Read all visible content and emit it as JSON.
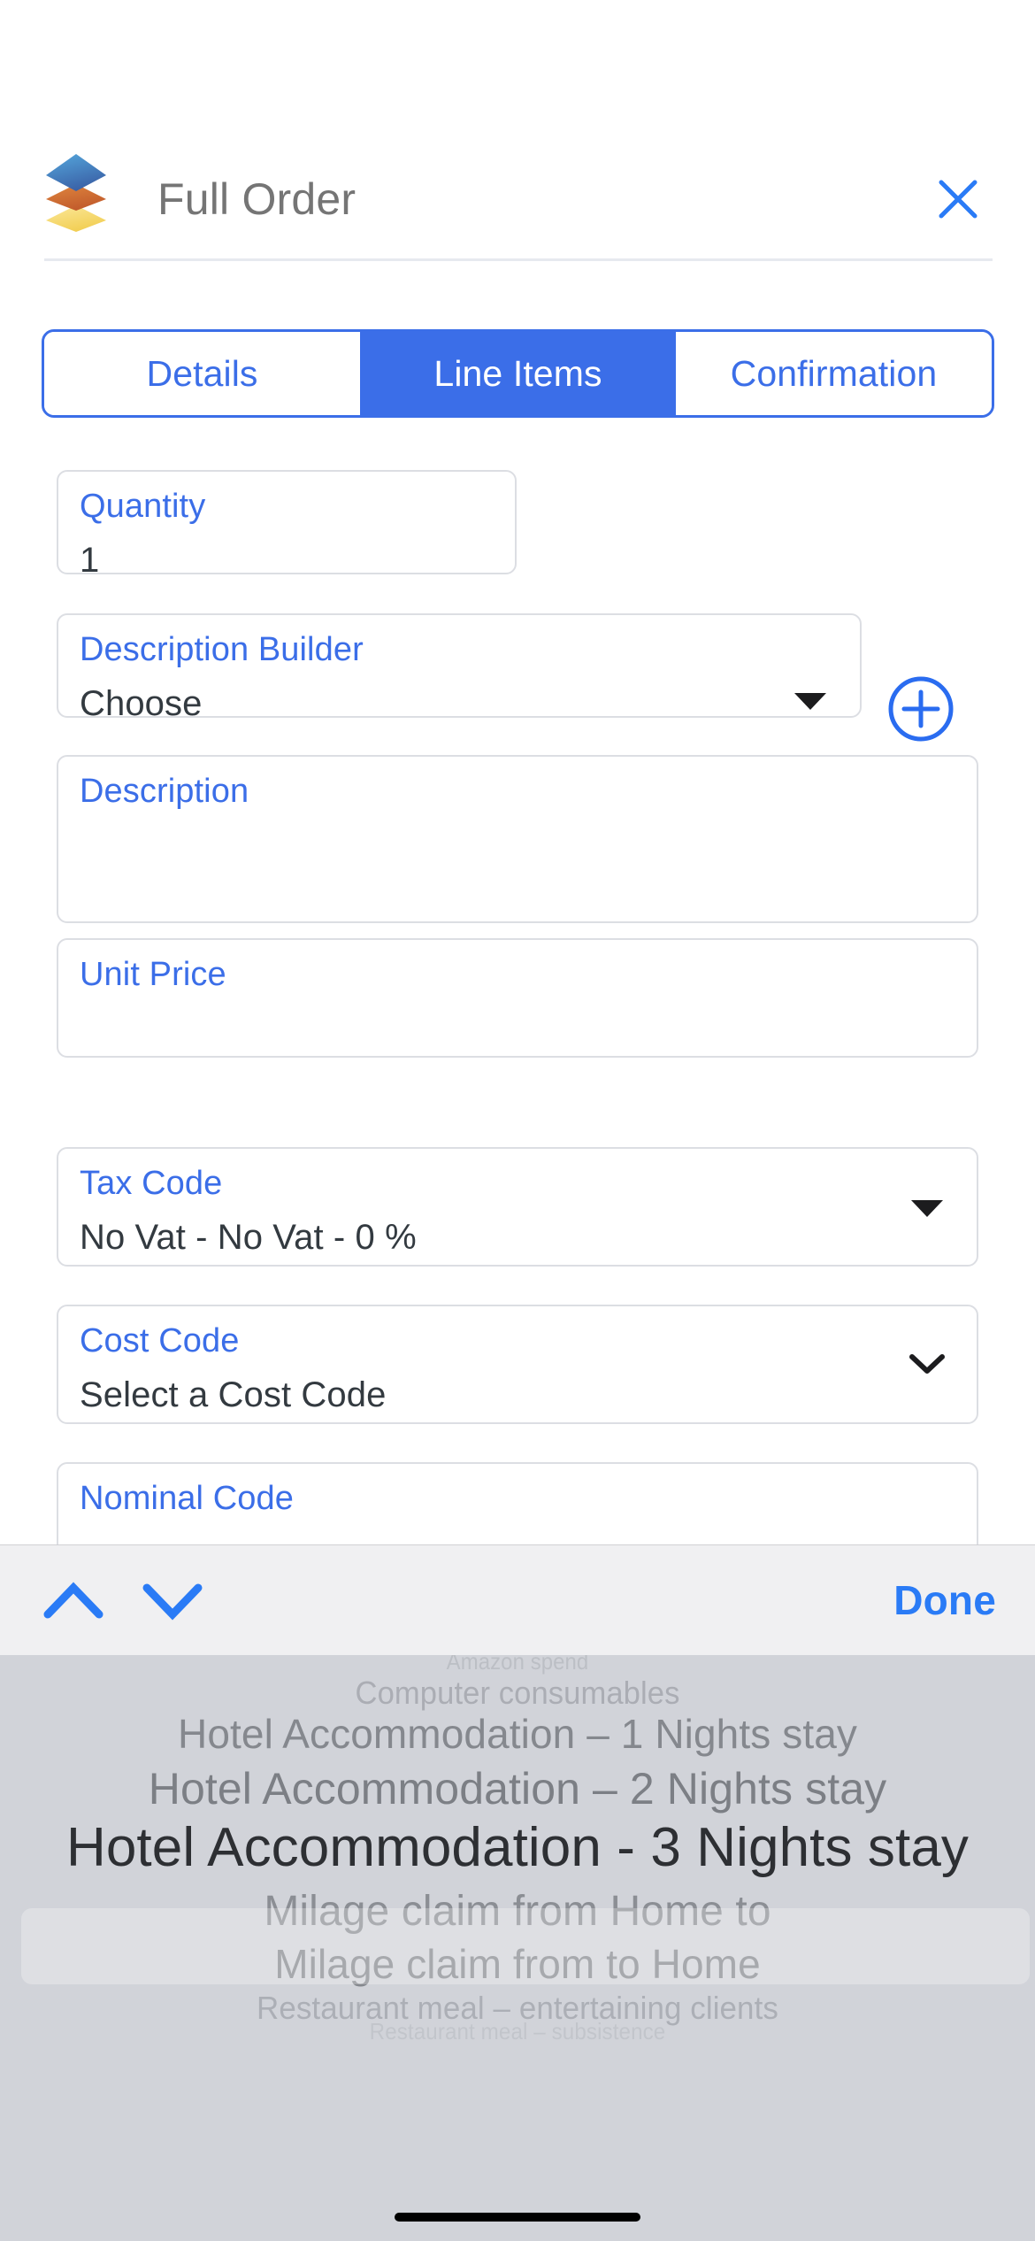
{
  "header": {
    "title": "Full Order",
    "logo_icon": "stacked-layers-icon",
    "logo_colors": [
      "#3d8cc9",
      "#d2703a",
      "#f7d96b"
    ],
    "close_icon": "close-icon",
    "close_color": "#2a7bf6"
  },
  "tabs": {
    "accent": "#3b6ee8",
    "items": [
      {
        "label": "Details",
        "active": false
      },
      {
        "label": "Line Items",
        "active": true
      },
      {
        "label": "Confirmation",
        "active": false
      }
    ]
  },
  "form": {
    "label_color": "#3b6ee8",
    "fields": {
      "quantity": {
        "label": "Quantity",
        "value": "1"
      },
      "description_builder": {
        "label": "Description Builder",
        "value": "Choose",
        "chevron_icon": "chevron-down-icon"
      },
      "description": {
        "label": "Description",
        "value": ""
      },
      "unit_price": {
        "label": "Unit Price",
        "value": ""
      },
      "tax_code": {
        "label": "Tax Code",
        "value": "No Vat - No Vat - 0 %",
        "chevron_icon": "chevron-down-icon"
      },
      "cost_code": {
        "label": "Cost Code",
        "value": "Select a Cost Code",
        "chevron_icon": "chevron-down-icon"
      },
      "nominal_code": {
        "label": "Nominal Code",
        "value": ""
      }
    },
    "add_button": {
      "icon": "plus-circle-icon",
      "color": "#2a6cf0"
    }
  },
  "accessory_bar": {
    "prev_icon": "chevron-up-icon",
    "next_icon": "chevron-down-icon",
    "done_label": "Done",
    "accent": "#2a7bf6",
    "background": "#f0f0f2"
  },
  "picker": {
    "background": "#d1d3d9",
    "selected_index": 3,
    "options": [
      "Amazon spend",
      "Computer consumables",
      "Hotel Accommodation – 1 Nights stay",
      "Hotel Accommodation – 2 Nights stay",
      "Hotel Accommodation - 3 Nights stay",
      "Milage claim from Home to",
      "Milage claim from to Home",
      "Restaurant meal – entertaining clients",
      "Restaurant meal – subsistence"
    ]
  }
}
